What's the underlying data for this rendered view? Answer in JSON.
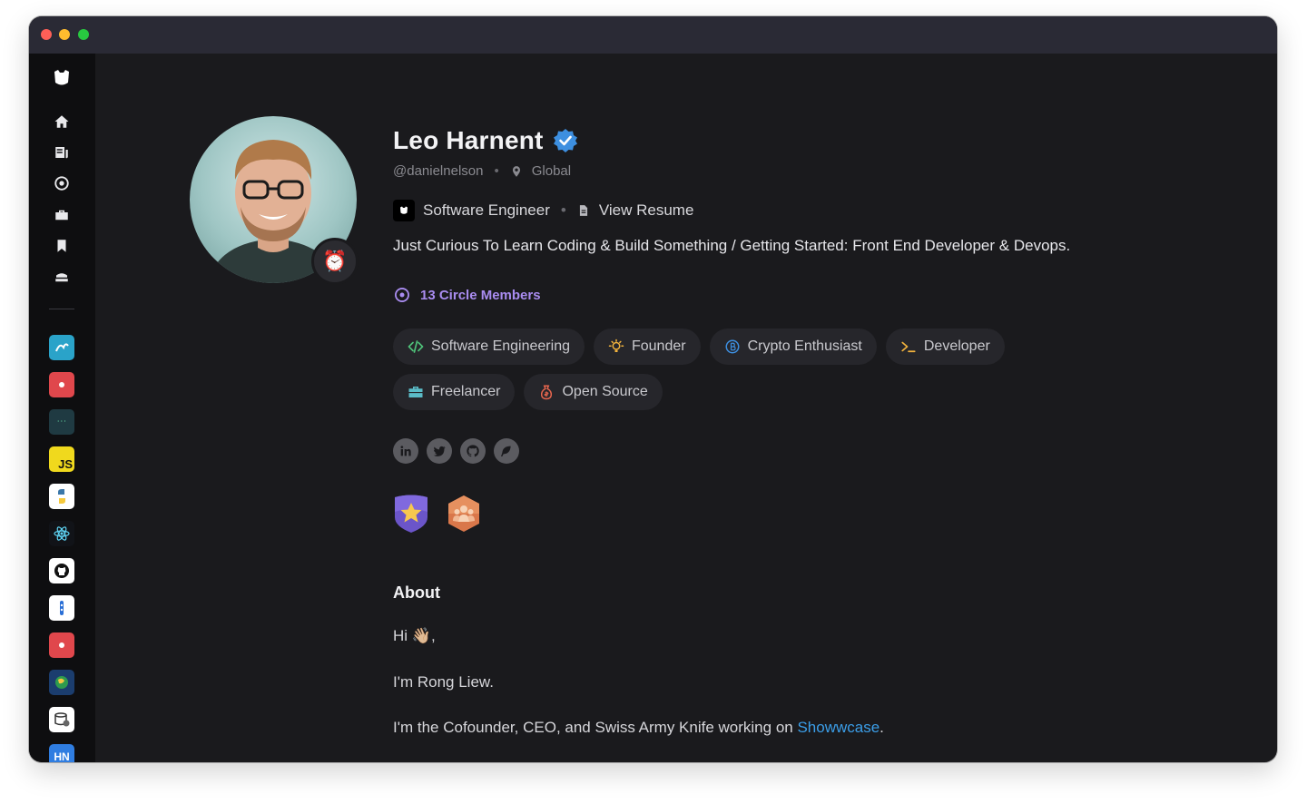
{
  "profile": {
    "name": "Leo Harnent",
    "handle": "@danielnelson",
    "location": "Global",
    "role": "Software Engineer",
    "resume_label": "View Resume",
    "bio": "Just Curious To Learn Coding & Build Something / Getting Started: Front End Developer & Devops.",
    "circle_members": "13 Circle Members",
    "status_emoji": "⏰"
  },
  "tags": [
    {
      "label": "Software Engineering",
      "icon": "code-icon"
    },
    {
      "label": "Founder",
      "icon": "lightbulb-icon"
    },
    {
      "label": "Crypto Enthusiast",
      "icon": "bitcoin-icon"
    },
    {
      "label": "Developer",
      "icon": "terminal-icon"
    },
    {
      "label": "Freelancer",
      "icon": "briefcase-icon"
    },
    {
      "label": "Open Source",
      "icon": "money-bag-icon"
    }
  ],
  "socials": [
    "linkedin-icon",
    "twitter-icon",
    "github-icon",
    "leaf-icon"
  ],
  "about": {
    "title": "About",
    "greeting_prefix": "Hi ",
    "greeting_emoji": "👋🏼",
    "greeting_suffix": ",",
    "line2": "I'm Rong Liew.",
    "line3_prefix": "I'm the Cofounder, CEO, and Swiss Army Knife working on ",
    "line3_link": "Showwcase",
    "line3_suffix": "."
  },
  "sidebar": {
    "nav": [
      "home-icon",
      "feed-icon",
      "circle-icon",
      "briefcase-icon",
      "bookmark-icon",
      "stack-icon"
    ],
    "apps": [
      {
        "name": "wave-app",
        "text": ""
      },
      {
        "name": "red-app",
        "text": ""
      },
      {
        "name": "dark-app",
        "text": "· · ·"
      },
      {
        "name": "javascript-app",
        "text": "JS"
      },
      {
        "name": "python-app",
        "text": ""
      },
      {
        "name": "react-app",
        "text": ""
      },
      {
        "name": "github-app",
        "text": ""
      },
      {
        "name": "blue-app",
        "text": ""
      },
      {
        "name": "red-app-2",
        "text": ""
      },
      {
        "name": "globe-app",
        "text": ""
      },
      {
        "name": "database-app",
        "text": ""
      },
      {
        "name": "hackernews-app",
        "text": "HN"
      }
    ]
  },
  "colors": {
    "background": "#1a1a1d",
    "sidebar": "#0e0e10",
    "accent_purple": "#a98cf0",
    "link_blue": "#3b9ee8",
    "verified_blue": "#3d8fe0"
  }
}
